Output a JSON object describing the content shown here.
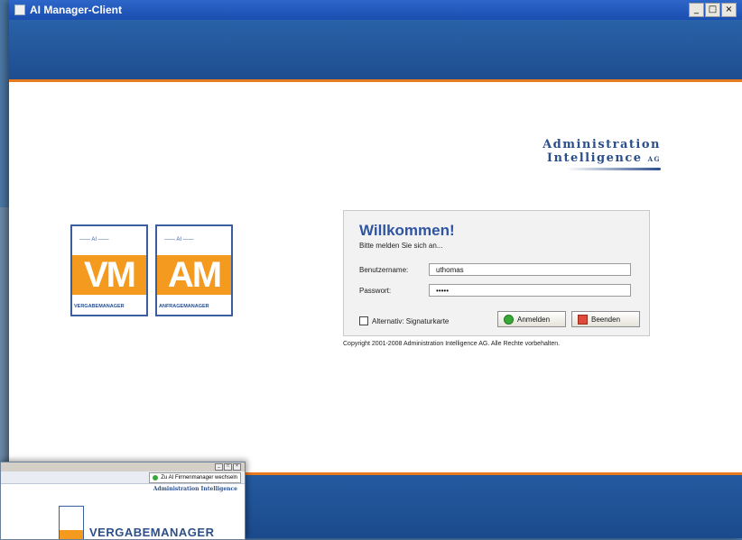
{
  "window": {
    "title": "AI Manager-Client",
    "controls": [
      "_",
      "□",
      "×"
    ]
  },
  "brand": {
    "line1": "Administration",
    "line2": "Intelligence",
    "suffix": "AG"
  },
  "product_logos": [
    {
      "letters": "VM",
      "caption": "VERGABEMANAGER"
    },
    {
      "letters": "AM",
      "caption": "ANFRAGEMANAGER"
    }
  ],
  "login": {
    "heading": "Willkommen!",
    "subtitle": "Bitte melden Sie sich an...",
    "username_label": "Benutzername:",
    "username_value": "uthomas",
    "password_label": "Passwort:",
    "password_value": "•••••",
    "checkbox_label": "Alternativ: Signaturkarte",
    "checkbox_checked": false,
    "login_button": "Anmelden",
    "exit_button": "Beenden"
  },
  "copyright": "Copyright 2001-2008 Administration Intelligence AG. Alle Rechte vorbehalten.",
  "inset_window": {
    "switch_button": "Zu AI Firmenmanager wechseln",
    "brand_small": "Administration Intelligence",
    "product_text": "VERGABEMANAGER"
  },
  "colors": {
    "banner_blue": "#1e4d8f",
    "accent_orange": "#e87a1e",
    "logo_orange": "#f39a1f",
    "heading_blue": "#2e54a3"
  }
}
